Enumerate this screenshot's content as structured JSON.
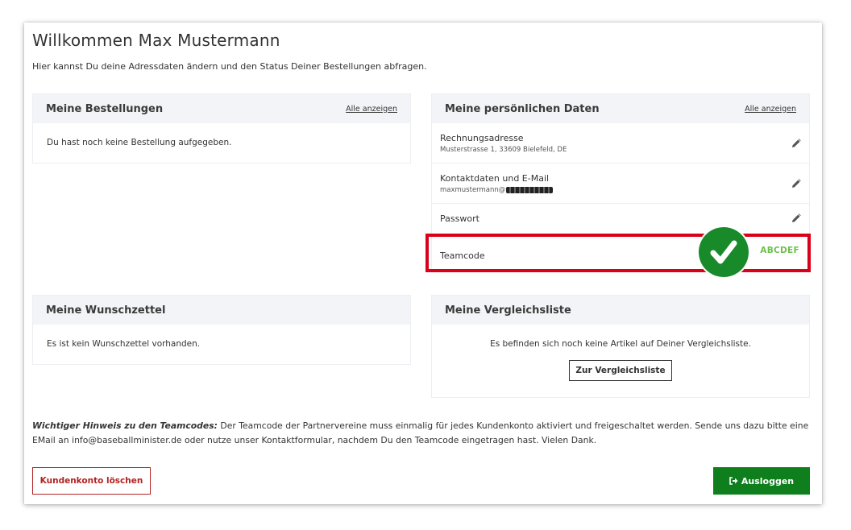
{
  "page": {
    "title": "Willkommen Max Mustermann",
    "intro": "Hier kannst Du deine Adressdaten ändern und den Status Deiner Bestellungen abfragen."
  },
  "orders": {
    "title": "Meine Bestellungen",
    "link": "Alle anzeigen",
    "empty_text": "Du hast noch keine Bestellung aufgegeben."
  },
  "personal": {
    "title": "Meine persönlichen Daten",
    "link": "Alle anzeigen",
    "rows": [
      {
        "label": "Rechnungsadresse",
        "value": "Musterstrasse 1, 33609 Bielefeld, DE",
        "icon": "pencil-icon"
      },
      {
        "label": "Kontaktdaten und E-Mail",
        "value": "maxmustermann@",
        "icon": "pencil-icon"
      },
      {
        "label": "Passwort",
        "icon": "pencil-icon"
      }
    ],
    "teamcode": {
      "label": "Teamcode",
      "value": "ABCDEF",
      "icon": "checkmark-icon"
    }
  },
  "wishlist": {
    "title": "Meine Wunschzettel",
    "empty_text": "Es ist kein Wunschzettel vorhanden."
  },
  "compare": {
    "title": "Meine Vergleichsliste",
    "empty_text": "Es befinden sich noch keine Artikel auf Deiner Vergleichsliste.",
    "button": "Zur Vergleichsliste"
  },
  "notice": {
    "lead": "Wichtiger Hinweis zu den Teamcodes:",
    "text": " Der Teamcode der Partnervereine muss einmalig für jedes Kundenkonto aktiviert und freigeschaltet werden. Sende uns dazu bitte eine EMail an info@baseballminister.de oder nutze unser Kontaktformular, nachdem Du den Teamcode eingetragen hast. Vielen Dank."
  },
  "actions": {
    "delete": "Kundenkonto löschen",
    "logout": "Ausloggen",
    "logout_icon": "logout-icon"
  },
  "colors": {
    "highlight_frame": "#d9001a",
    "check_green": "#198a2a",
    "teamcode_green": "#6cc04a",
    "logout_green": "#0f7f1e",
    "delete_red": "#b22222"
  }
}
